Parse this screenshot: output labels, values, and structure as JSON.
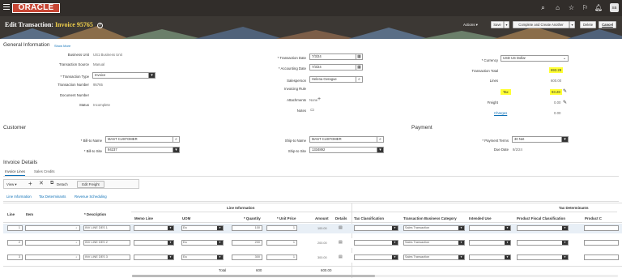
{
  "topbar": {
    "logo": "ORACLE",
    "avatar": "SB"
  },
  "header": {
    "title_prefix": "Edit Transaction:",
    "title_invoice": "Invoice 95765",
    "actions": "Actions ▾",
    "save": "Save",
    "complete_create": "Complete and Create Another",
    "delete": "Delete",
    "cancel": "Cancel"
  },
  "general": {
    "section": "General Information",
    "show_more": "Show More",
    "business_unit_label": "Business Unit",
    "business_unit": "US1 Business Unit",
    "transaction_source_label": "Transaction Source",
    "transaction_source": "Manual",
    "transaction_type_label": "* Transaction Type",
    "transaction_type": "Invoice",
    "transaction_number_label": "Transaction Number",
    "transaction_number": "95765",
    "document_number_label": "Document Number",
    "status_label": "Status",
    "status": "Incomplete",
    "transaction_date_label": "* Transaction Date",
    "transaction_date": "7/3/24",
    "accounting_date_label": "* Accounting Date",
    "accounting_date": "7/3/24",
    "salesperson_label": "Salesperson",
    "salesperson": "Helena Gerague",
    "invoicing_rule_label": "Invoicing Rule",
    "attachments_label": "Attachments",
    "attachments": "None",
    "notes_label": "Notes",
    "currency_label": "* Currency",
    "currency": "USD US Dollar",
    "transaction_total_label": "Transaction Total",
    "transaction_total": "693.28",
    "lines_label": "Lines",
    "lines": "600.00",
    "tax_label": "Tax",
    "tax": "93.28",
    "freight_label": "Freight",
    "freight": "0.00",
    "charges_label": "Charges",
    "charges": "0.00"
  },
  "customer": {
    "section": "Customer",
    "bill_to_name_label": "* Bill-to Name",
    "bill_to_name": "MAST CUSTOMER",
    "bill_to_site_label": "* Bill-to Site",
    "bill_to_site": "94237",
    "ship_to_name_label": "Ship-to Name",
    "ship_to_name": "MAST CUSTOMER",
    "ship_to_site_label": "Ship-to Site",
    "ship_to_site": "1334892"
  },
  "payment": {
    "section": "Payment",
    "payment_terms_label": "* Payment Terms",
    "payment_terms": "30 Net",
    "due_date_label": "Due Date",
    "due_date": "8/2/24"
  },
  "invoice_details": {
    "section": "Invoice Details",
    "tabs": [
      "Invoice Lines",
      "Sales Credits"
    ],
    "subtabs": [
      "Line Information",
      "Tax Determinants",
      "Revenue Scheduling"
    ],
    "toolbar": {
      "view": "View ▾",
      "detach": "Detach",
      "edit_freight": "Edit Freight"
    },
    "group_line_info": "Line Information",
    "group_tax": "Tax Determinants",
    "headers": {
      "line": "Line",
      "item": "Item",
      "description": "* Description",
      "memo_line": "Memo Line",
      "uom": "UOM",
      "quantity": "* Quantity",
      "unit_price": "* Unit Price",
      "amount": "Amount",
      "details": "Details",
      "tax_classification": "Tax Classification",
      "tbc": "Transaction Business Category",
      "intended_use": "Intended Use",
      "pfc": "Product Fiscal Classification",
      "product_category": "Product C"
    },
    "rows": [
      {
        "line": "1",
        "description": "INV LINE DES 1",
        "uom": "Ea",
        "quantity": "100",
        "unit_price": "1",
        "amount": "100.00",
        "tbc": "Sales Transaction"
      },
      {
        "line": "2",
        "description": "INV LINE DES 2",
        "uom": "Ea",
        "quantity": "200",
        "unit_price": "1",
        "amount": "200.00",
        "tbc": "Sales Transaction"
      },
      {
        "line": "3",
        "description": "INV LINE DES 3",
        "uom": "Ea",
        "quantity": "300",
        "unit_price": "1",
        "amount": "300.00",
        "tbc": "Sales Transaction"
      }
    ],
    "total_label": "Total",
    "total_quantity": "600",
    "total_amount": "600.00"
  }
}
